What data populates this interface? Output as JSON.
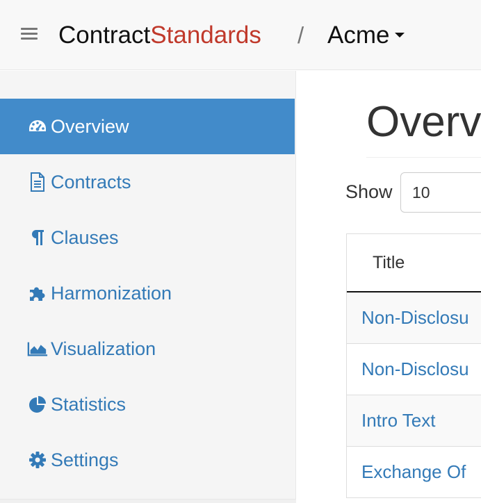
{
  "navbar": {
    "brand_part1": "Contract",
    "brand_part2": "Standards",
    "separator": "/",
    "organization": "Acme",
    "brand_color_1": "#111111",
    "brand_color_2": "#c0392b"
  },
  "sidebar": {
    "items": [
      {
        "label": "Overview",
        "icon": "dashboard-icon",
        "active": true
      },
      {
        "label": "Contracts",
        "icon": "file-text-icon",
        "active": false
      },
      {
        "label": "Clauses",
        "icon": "paragraph-icon",
        "active": false
      },
      {
        "label": "Harmonization",
        "icon": "puzzle-piece-icon",
        "active": false
      },
      {
        "label": "Visualization",
        "icon": "area-chart-icon",
        "active": false
      },
      {
        "label": "Statistics",
        "icon": "pie-chart-icon",
        "active": false
      },
      {
        "label": "Settings",
        "icon": "gear-icon",
        "active": false
      }
    ],
    "active_color": "#428bca",
    "link_color": "#337ab7"
  },
  "main": {
    "title": "Overv",
    "show_label": "Show",
    "page_length_value": "10",
    "table": {
      "headers": [
        "Title"
      ],
      "rows": [
        {
          "title": "Non-Disclosu"
        },
        {
          "title": "Non-Disclosu"
        },
        {
          "title": "Intro Text"
        },
        {
          "title": "Exchange Of"
        }
      ]
    }
  }
}
